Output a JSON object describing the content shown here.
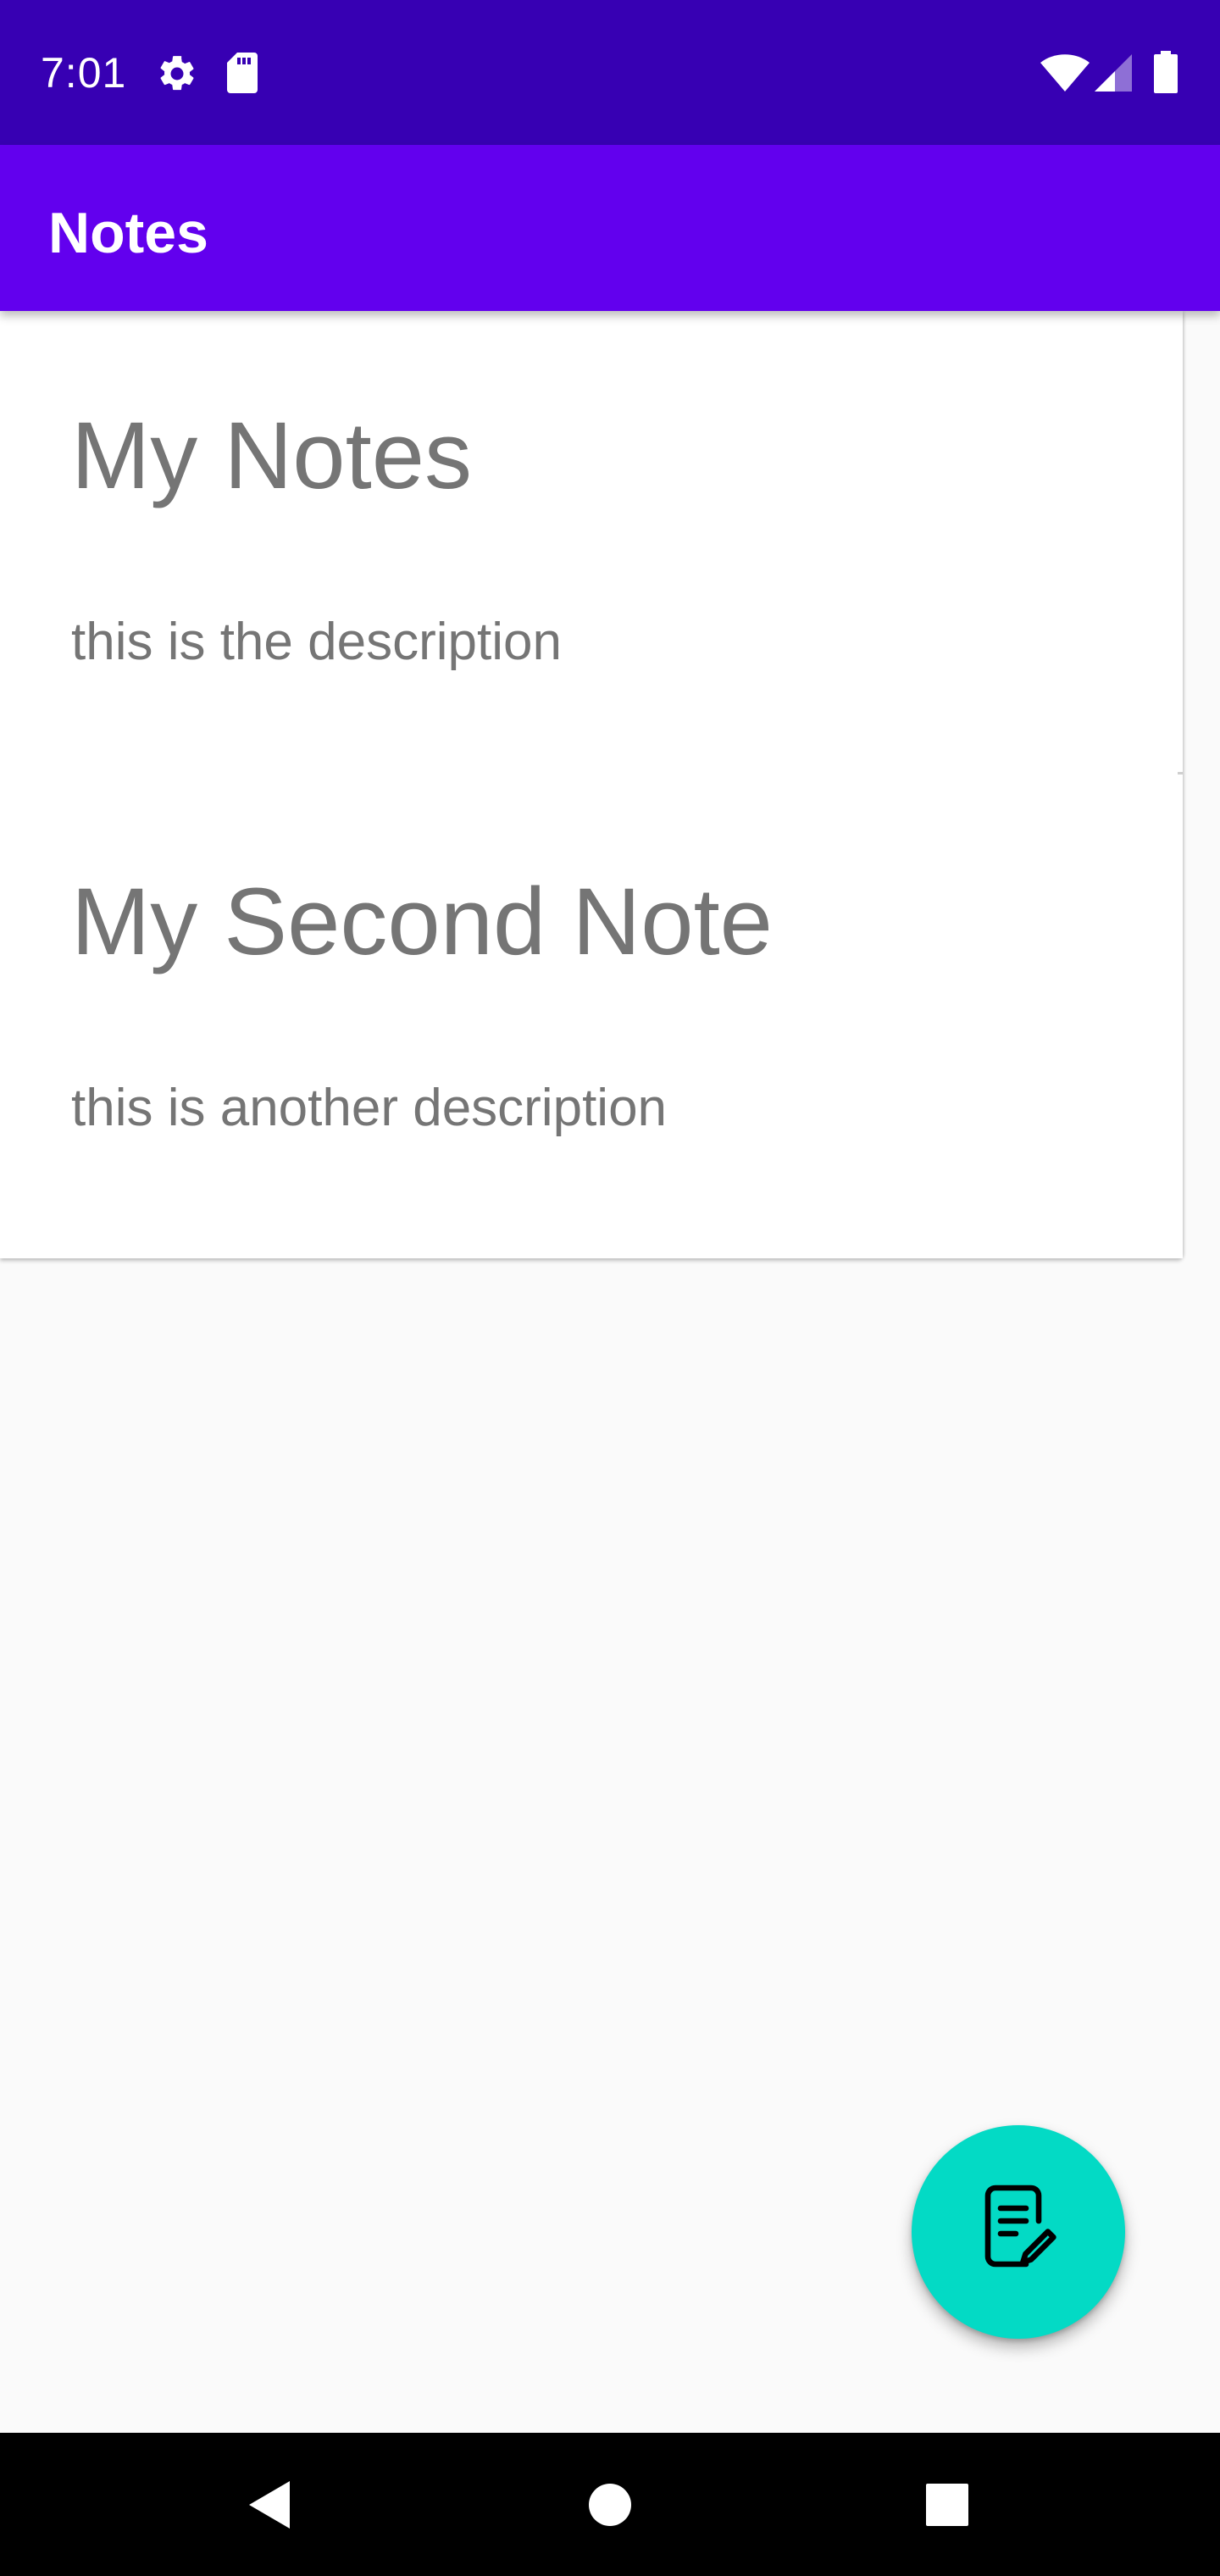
{
  "status_bar": {
    "time": "7:01",
    "icons": [
      "settings-icon",
      "sd-card-icon",
      "wifi-icon",
      "cellular-signal-icon",
      "battery-icon"
    ],
    "background": "#3700b3"
  },
  "app_bar": {
    "title": "Notes",
    "background": "#6200ee"
  },
  "notes": [
    {
      "title": "My Notes",
      "description": "this is the description"
    },
    {
      "title": "My Second Note",
      "description": "this is another description"
    }
  ],
  "fab": {
    "icon": "edit-note-icon",
    "color": "#03dac5"
  },
  "nav_bar": {
    "buttons": [
      "back-icon",
      "home-icon",
      "recents-icon"
    ]
  },
  "colors": {
    "text_secondary": "#757575",
    "surface": "#ffffff",
    "background": "#fafafa"
  }
}
